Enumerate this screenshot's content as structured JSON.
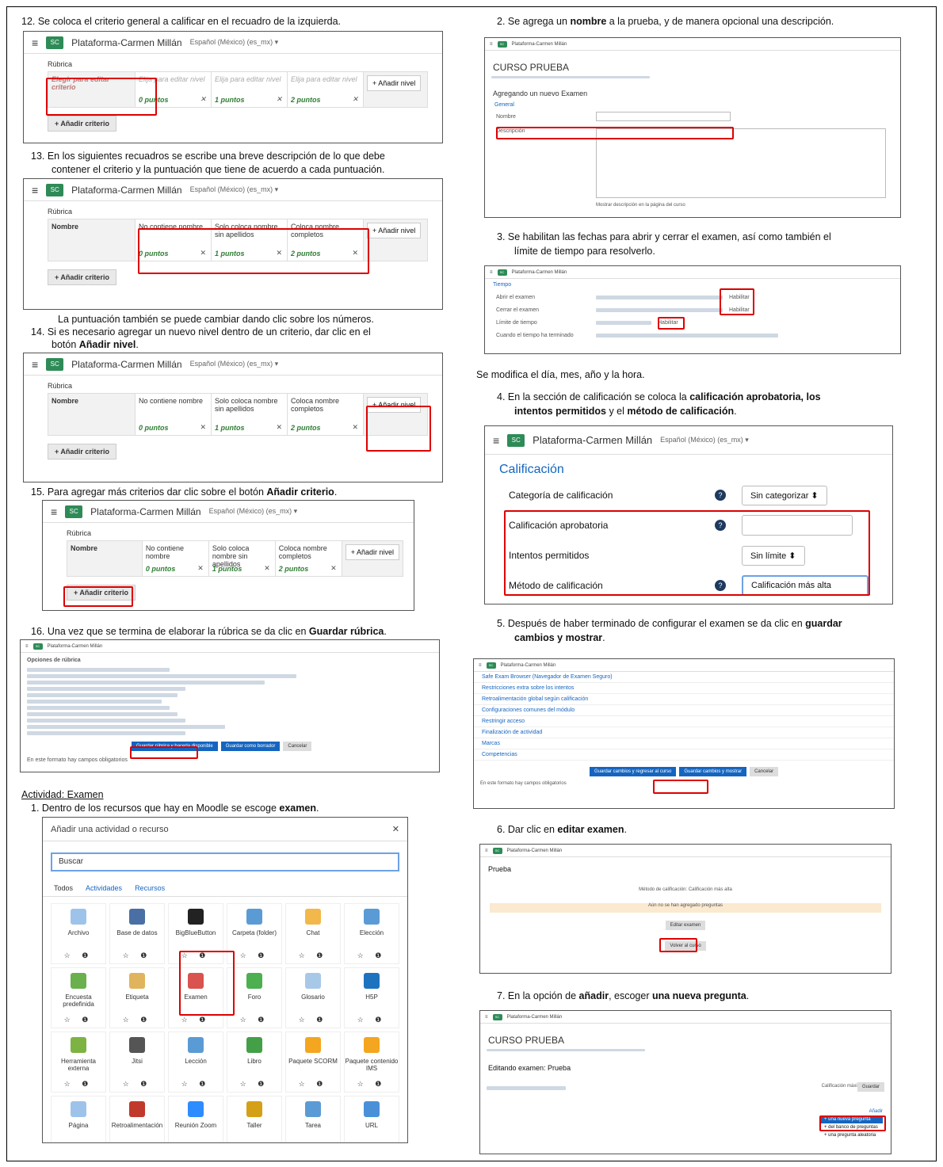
{
  "left": {
    "step12": "12. Se coloca el criterio general a calificar en el recuadro de la izquierda.",
    "step13a": "13. En los siguientes recuadros se escribe una breve descripción de lo que debe",
    "step13b": "contener el criterio y la puntuación que tiene de acuerdo a cada puntuación.",
    "note13": "La puntuación también se puede cambiar dando clic sobre los números.",
    "step14a": "14. Si es necesario agregar un nuevo nivel dentro de un criterio, dar clic en el",
    "step14b_pre": "botón ",
    "step14b_bold": "Añadir nivel",
    "step14b_post": ".",
    "step15_pre": "15. Para agregar más criterios dar clic sobre el botón ",
    "step15_bold": "Añadir criterio",
    "step15_post": ".",
    "step16_pre": "16. Una vez que se termina de elaborar la rúbrica se da clic en ",
    "step16_bold": "Guardar rúbrica",
    "step16_post": ".",
    "activity_heading": "Actividad: Examen",
    "step1_pre": "1.  Dentro de los recursos que hay en Moodle se escoge ",
    "step1_bold": "examen",
    "step1_post": "."
  },
  "moodle": {
    "site_name": "Plataforma-Carmen Millán",
    "language": "Español (México) (es_mx) ▾",
    "menu_icon": "≡",
    "logo_text": "SC"
  },
  "rubric": {
    "label": "Rúbrica",
    "placeholder_crit": "Elegir para editar criterio",
    "placeholder_lvl": "Elija para editar nivel",
    "criterion": "Nombre",
    "levels": [
      {
        "text": "No contiene nombre",
        "points": "0 puntos"
      },
      {
        "text": "Solo coloca nombre sin apellidos",
        "points": "1 puntos"
      },
      {
        "text": "Coloca nombre completos",
        "points": "2 puntos"
      }
    ],
    "add_level": "+ Añadir nivel",
    "add_criterion": "+ Añadir criterio",
    "remove": "✕"
  },
  "rubric_options": {
    "title": "Opciones de rúbrica",
    "save_btn": "Guardar rúbrica y hacerla disponible",
    "draft_btn": "Guardar como borrador",
    "cancel_btn": "Cancelar",
    "required": "En este formato hay campos obligatorios"
  },
  "activity_modal": {
    "title": "Añadir una actividad o recurso",
    "close": "✕",
    "search": "Buscar",
    "tabs": [
      "Todos",
      "Actividades",
      "Recursos"
    ],
    "star_info": "☆ ❶",
    "tiles": [
      {
        "label": "Archivo",
        "color": "#9ec3ea"
      },
      {
        "label": "Base de datos",
        "color": "#4a6fa5"
      },
      {
        "label": "BigBlueButton",
        "color": "#222222"
      },
      {
        "label": "Carpeta (folder)",
        "color": "#5b9bd5"
      },
      {
        "label": "Chat",
        "color": "#f2b84b"
      },
      {
        "label": "Elección",
        "color": "#5b9bd5"
      },
      {
        "label": "Encuesta predefinida",
        "color": "#6ab04c"
      },
      {
        "label": "Etiqueta",
        "color": "#e0b45c"
      },
      {
        "label": "Examen",
        "color": "#d9534f"
      },
      {
        "label": "Foro",
        "color": "#4caf50"
      },
      {
        "label": "Glosario",
        "color": "#a8c8e8"
      },
      {
        "label": "H5P",
        "color": "#1e73be"
      },
      {
        "label": "Herramienta externa",
        "color": "#7cb342"
      },
      {
        "label": "Jitsi",
        "color": "#555555"
      },
      {
        "label": "Lección",
        "color": "#5b9bd5"
      },
      {
        "label": "Libro",
        "color": "#43a047"
      },
      {
        "label": "Paquete SCORM",
        "color": "#f4a620"
      },
      {
        "label": "Paquete contenido IMS",
        "color": "#f4a620"
      },
      {
        "label": "Página",
        "color": "#9ec3ea"
      },
      {
        "label": "Retroalimentación",
        "color": "#c0392b"
      },
      {
        "label": "Reunión Zoom",
        "color": "#2d8cff"
      },
      {
        "label": "Taller",
        "color": "#d4a017"
      },
      {
        "label": "Tarea",
        "color": "#5b9bd5"
      },
      {
        "label": "URL",
        "color": "#4a90d9"
      }
    ]
  },
  "right": {
    "step2_pre": "2.  Se agrega un ",
    "step2_bold": "nombre",
    "step2_post": " a la prueba, y de manera opcional una descripción.",
    "step3a": "3.  Se habilitan las fechas para abrir y cerrar el examen, así como también el",
    "step3b": "límite de tiempo para resolverlo.",
    "note3": "Se modifica el día, mes, año y la hora.",
    "step4a_pre": "4.  En la sección de calificación se coloca la ",
    "step4a_bold": "calificación aprobatoria",
    "step4a_post": ", los",
    "step4b_bold1": "intentos permitidos",
    "step4b_mid": " y el ",
    "step4b_bold2": "método de calificación",
    "step4b_post": ".",
    "step5a_pre": "5.  Después de haber terminado de configurar el examen se da clic en ",
    "step5a_bold": "guardar",
    "step5b_bold": "cambios y mostrar",
    "step5b_post": ".",
    "step6_pre": "6.  Dar clic en ",
    "step6_bold": "editar examen",
    "step6_post": ".",
    "step7_pre": "7.  En la opción de ",
    "step7_bold1": "añadir",
    "step7_mid": ", escoger ",
    "step7_bold2": "una nueva pregunta",
    "step7_post": "."
  },
  "exam_form": {
    "course": "CURSO PRUEBA",
    "adding": "Agregando un nuevo Examen",
    "general": "General",
    "name_label": "Nombre",
    "desc_label": "Descripción",
    "show_desc": "Mostrar descripción en la página del curso"
  },
  "timing": {
    "section": "Tiempo",
    "open": "Abrir el examen",
    "close": "Cerrar el examen",
    "limit": "Límite de tiempo",
    "expire": "Cuando el tiempo ha terminado",
    "enable": "Habilitar"
  },
  "grading": {
    "section": "Calificación",
    "category_label": "Categoría de calificación",
    "category_value": "Sin categorizar ⬍",
    "pass_label": "Calificación aprobatoria",
    "attempts_label": "Intentos permitidos",
    "attempts_value": "Sin límite ⬍",
    "method_label": "Método de calificación",
    "method_value": "Calificación más alta",
    "help": "?"
  },
  "settings_sections": [
    "Safe Exam Browser (Navegador de Examen Seguro)",
    "Restricciones extra sobre los intentos",
    "Retroalimentación global según calificación",
    "Configuraciones comunes del módulo",
    "Restringir acceso",
    "Finalización de actividad",
    "Marcas",
    "Competencias"
  ],
  "save_buttons": {
    "return": "Guardar cambios y regresar al curso",
    "display": "Guardar cambios y mostrar",
    "cancel": "Cancelar"
  },
  "quiz_view": {
    "title": "Prueba",
    "method": "Método de calificación: Calificación más alta",
    "no_questions": "Aún no se han agregado preguntas",
    "edit_btn": "Editar examen",
    "back_btn": "Volver al curso"
  },
  "edit_quiz": {
    "course": "CURSO PRUEBA",
    "title": "Editando examen: Prueba",
    "add": "Añadir",
    "new_q": "+ una nueva pregunta",
    "bank_q": "+ del banco de preguntas",
    "random_q": "+ una pregunta aleatoria",
    "max_grade": "Calificación máxima",
    "save": "Guardar"
  }
}
